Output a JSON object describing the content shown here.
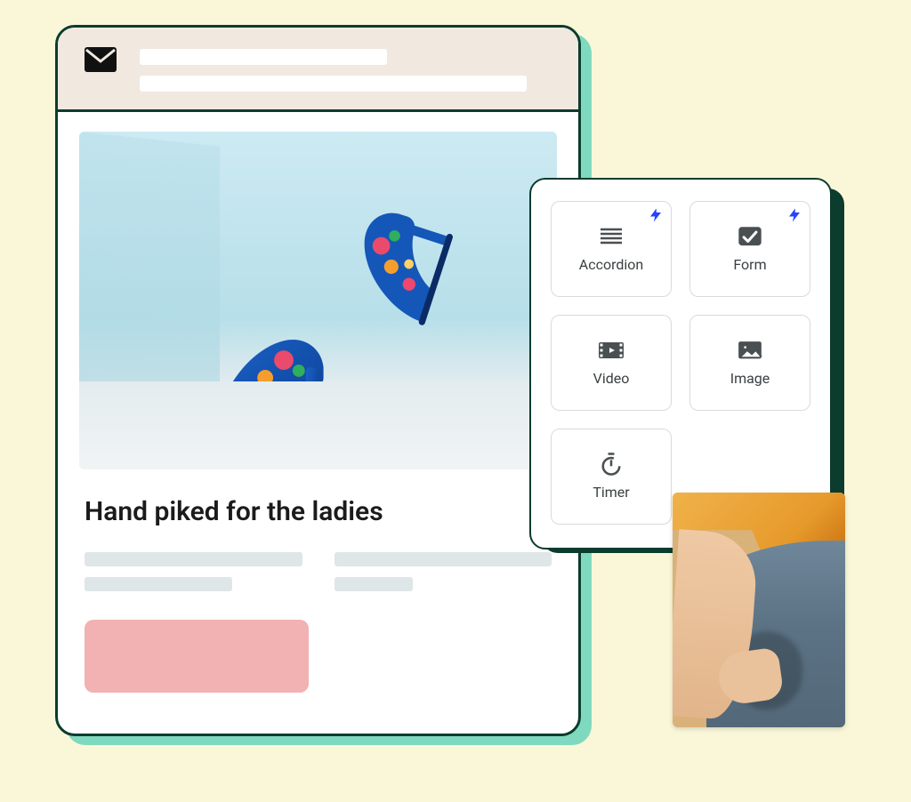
{
  "email": {
    "headline": "Hand piked for the ladies",
    "hero_alt": "Blue floral high-heel shoes on a light blue studio backdrop",
    "cta_label": ""
  },
  "widgets": [
    {
      "id": "accordion",
      "label": "Accordion",
      "icon": "accordion-icon",
      "bolt": true
    },
    {
      "id": "form",
      "label": "Form",
      "icon": "form-icon",
      "bolt": true
    },
    {
      "id": "video",
      "label": "Video",
      "icon": "video-icon",
      "bolt": false
    },
    {
      "id": "image",
      "label": "Image",
      "icon": "image-icon",
      "bolt": false
    },
    {
      "id": "timer",
      "label": "Timer",
      "icon": "timer-icon",
      "bolt": false
    }
  ],
  "thumb_alt": "Close-up of a person with hand in pocket of blue trousers, yellow shirt",
  "colors": {
    "page_bg": "#faf7d9",
    "card_border": "#0b3c2e",
    "shadow_teal": "#7fd9be",
    "header_bg": "#f1e8df",
    "cta_bg": "#f2b1b2",
    "bolt": "#2542ff",
    "placeholder_grey": "#dfe6e7"
  }
}
